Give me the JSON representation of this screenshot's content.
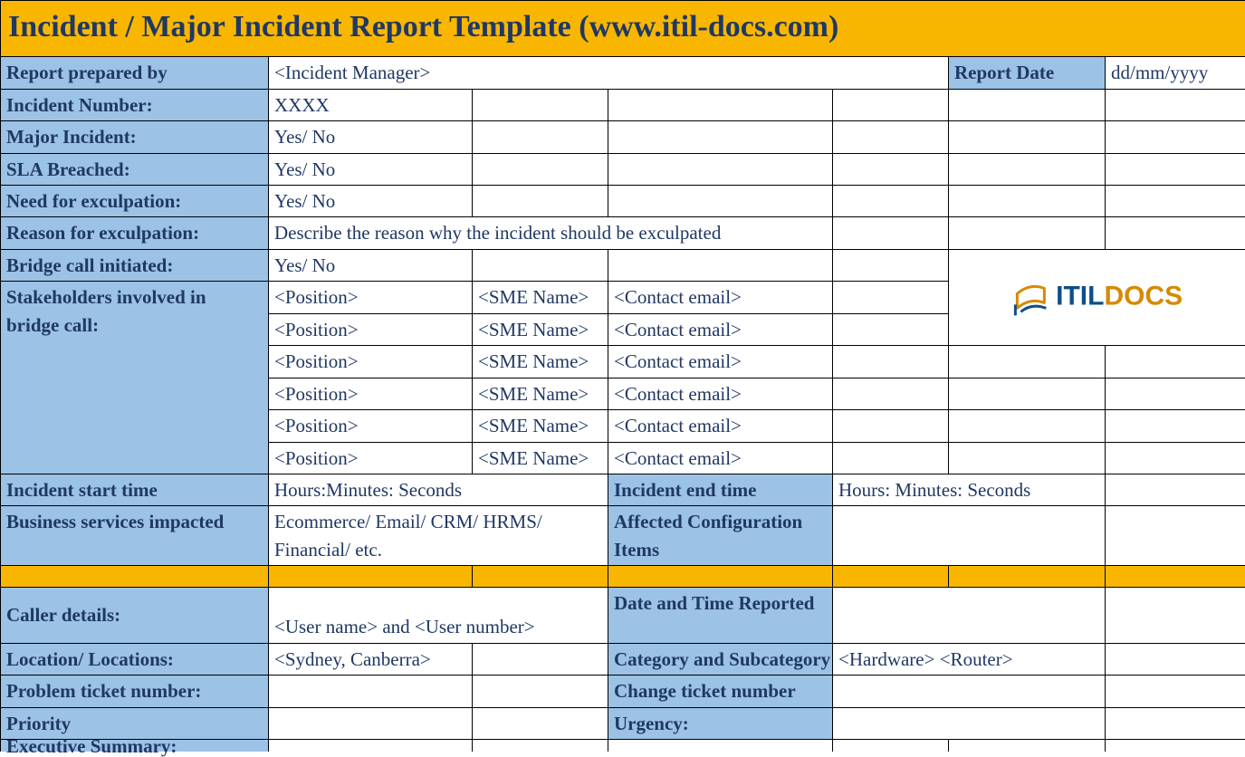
{
  "title": "Incident / Major Incident Report Template   (www.itil-docs.com)",
  "logo": {
    "part1": "ITIL",
    "part2": "DOCS"
  },
  "labels": {
    "report_prepared_by": "Report prepared by",
    "report_date": "Report Date",
    "incident_number": "Incident Number:",
    "major_incident": "Major Incident:",
    "sla_breached": "SLA Breached:",
    "need_exculpation": "Need for exculpation:",
    "reason_exculpation": "Reason for exculpation:",
    "bridge_call": "Bridge call initiated:",
    "stakeholders": "Stakeholders involved in bridge call:",
    "incident_start": "Incident start time",
    "incident_end": "Incident end time",
    "business_services": "Business services impacted",
    "affected_ci": "Affected Configuration Items",
    "caller_details": "Caller details:",
    "date_time_reported": "Date and Time Reported",
    "location": "Location/ Locations:",
    "category_subcat": "Category and Subcategory",
    "problem_ticket": "Problem ticket number:",
    "change_ticket": "Change ticket number",
    "priority": "Priority",
    "urgency": "Urgency:",
    "exec_summary": "Executive Summary:"
  },
  "values": {
    "prepared_by": "<Incident Manager>",
    "report_date": "dd/mm/yyyy",
    "incident_number": "XXXX",
    "major_incident": "Yes/ No",
    "sla_breached": "Yes/ No",
    "need_exculpation": "Yes/ No",
    "reason_exculpation": "Describe the reason why the incident should be exculpated",
    "bridge_call": "Yes/ No",
    "incident_start": "Hours:Minutes: Seconds",
    "incident_end": "Hours: Minutes: Seconds",
    "business_services": "Ecommerce/ Email/ CRM/ HRMS/ Financial/ etc.",
    "caller_details": "<User name> and <User number>",
    "location": "<Sydney, Canberra>",
    "category_subcat": "<Hardware> <Router>"
  },
  "stakeholders": [
    {
      "position": "<Position>",
      "sme": "<SME Name>",
      "email": "<Contact email>"
    },
    {
      "position": "<Position>",
      "sme": "<SME Name>",
      "email": "<Contact email>"
    },
    {
      "position": "<Position>",
      "sme": "<SME Name>",
      "email": "<Contact email>"
    },
    {
      "position": "<Position>",
      "sme": "<SME Name>",
      "email": "<Contact email>"
    },
    {
      "position": "<Position>",
      "sme": "<SME Name>",
      "email": "<Contact email>"
    },
    {
      "position": "<Position>",
      "sme": "<SME Name>",
      "email": "<Contact email>"
    }
  ]
}
